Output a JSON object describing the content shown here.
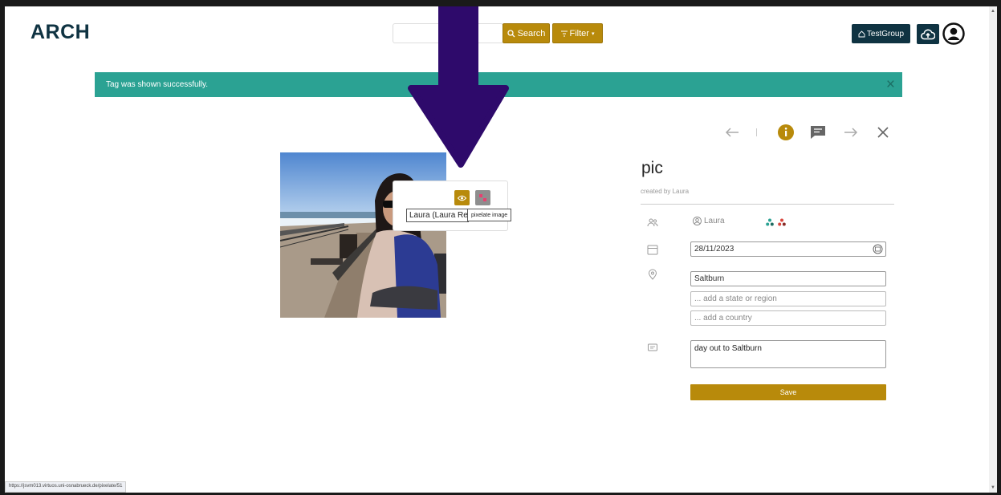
{
  "app": {
    "logo": "ARCH",
    "search_placeholder": "",
    "search_label": "Search",
    "filter_label": "Filter",
    "group_label": "TestGroup"
  },
  "alert": {
    "message": "Tag was shown successfully.",
    "close": "×"
  },
  "tag": {
    "name": "Laura (Laura Re",
    "tooltip": "pixelate image"
  },
  "details": {
    "title": "pic",
    "created_by": "created by Laura",
    "person": "Laura",
    "date": "28/11/2023",
    "city": "Saltburn",
    "region_placeholder": "... add a state or region",
    "country_placeholder": "... add a country",
    "description": "day out to Saltburn",
    "save_label": "Save"
  },
  "status": {
    "url": "https://jsvm013.virtuos.uni-osnabrueck.de/pixelate/51"
  },
  "colors": {
    "primary_dark": "#0f3342",
    "accent_gold": "#b88a0b",
    "alert_teal": "#2ba293",
    "annotation_arrow": "#2e0a6b"
  },
  "icons": {
    "toolbar": [
      "arrow-left-icon",
      "info-icon",
      "comment-icon",
      "arrow-right-icon",
      "close-icon"
    ],
    "header": [
      "search-icon",
      "filter-icon",
      "home-icon",
      "cloud-upload-icon",
      "account-icon"
    ]
  }
}
